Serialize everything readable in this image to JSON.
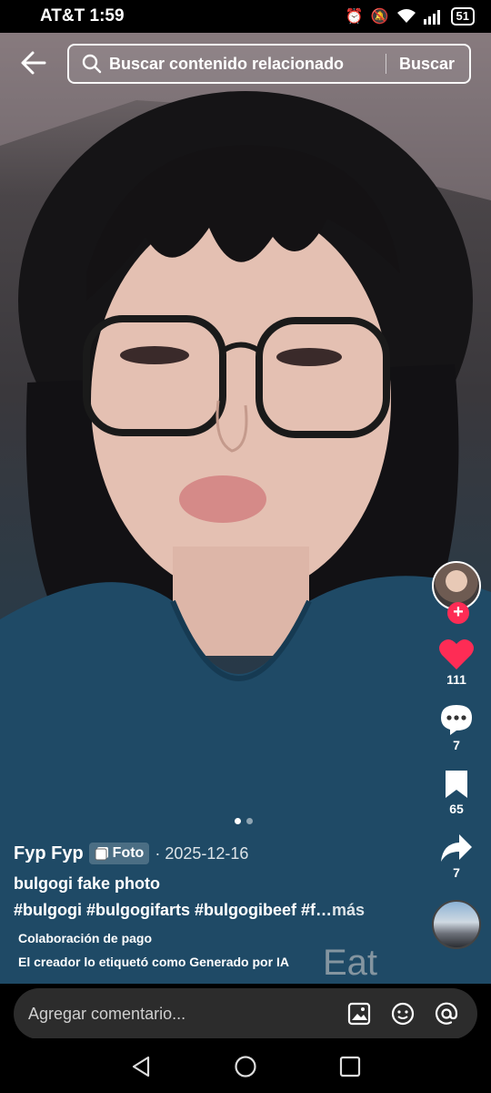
{
  "status_bar": {
    "carrier_time": "AT&T 1:59",
    "battery": "51"
  },
  "search": {
    "placeholder": "Buscar contenido relacionado",
    "button_label": "Buscar"
  },
  "actions": {
    "likes": "111",
    "comments": "7",
    "saves": "65",
    "shares": "7"
  },
  "post": {
    "username": "Fyp Fyp",
    "badge": "Foto",
    "date": "· 2025-12-16",
    "description": "bulgogi fake photo",
    "hashtags": "#bulgogi #bulgogifarts #bulgogibeef #f…",
    "more_label": "más",
    "paid_label": "Colaboración de pago",
    "ai_label": "El creador lo etiquetó como Generado por IA",
    "slide_index": 1,
    "slide_count": 2
  },
  "comment": {
    "placeholder": "Agregar comentario..."
  },
  "colors": {
    "like": "#fe2c55",
    "follow": "#fe2c55"
  }
}
